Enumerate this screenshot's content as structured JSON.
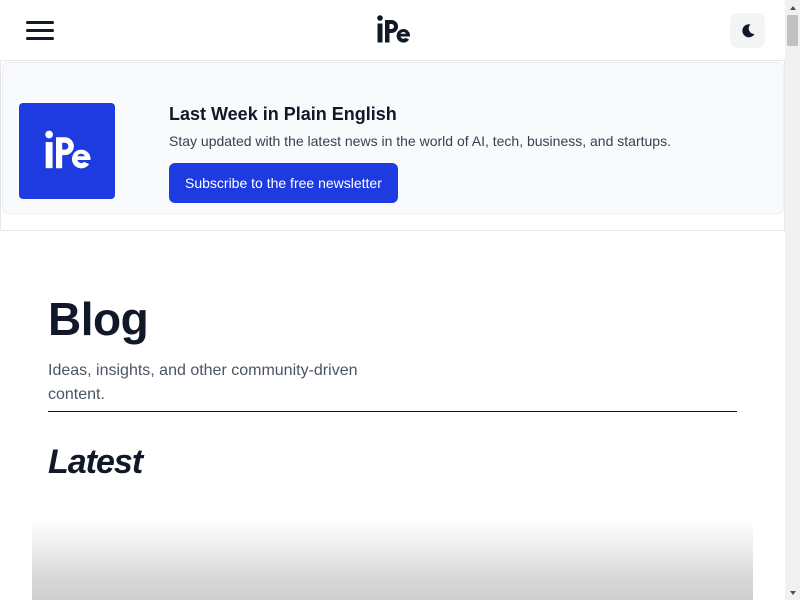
{
  "header": {
    "menu_icon": "hamburger-menu-icon",
    "logo_text": "iPe",
    "theme_toggle_icon": "moon-icon"
  },
  "newsletter": {
    "logo_icon": "ipe-logo-icon",
    "title": "Last Week in Plain English",
    "description": "Stay updated with the latest news in the world of AI, tech, business, and startups.",
    "button_label": "Subscribe to the free newsletter",
    "accent_color": "#1d3be0"
  },
  "blog": {
    "title": "Blog",
    "description": "Ideas, insights, and other community-driven content.",
    "latest_heading": "Latest"
  },
  "scrollbar": {
    "up_icon": "scroll-up-arrow-icon",
    "down_icon": "scroll-down-arrow-icon"
  }
}
